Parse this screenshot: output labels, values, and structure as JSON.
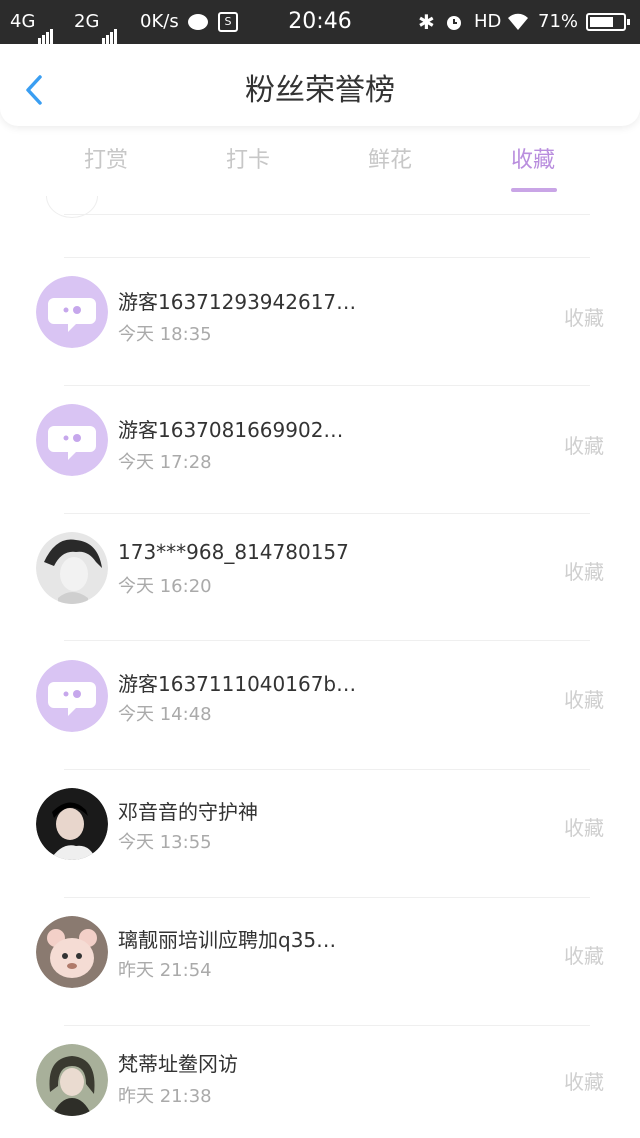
{
  "status_bar": {
    "network_1": "4G",
    "network_2": "2G",
    "speed": "0K/s",
    "time": "20:46",
    "hd": "HD",
    "battery_percent": "71%",
    "battery_level": 0.71
  },
  "header": {
    "title": "粉丝荣誉榜"
  },
  "tabs": [
    {
      "label": "打赏"
    },
    {
      "label": "打卡"
    },
    {
      "label": "鲜花"
    },
    {
      "label": "收藏",
      "active": true
    }
  ],
  "colors": {
    "accent": "#b98ede",
    "back": "#3a9ef2",
    "placeholder_avatar": "#d9c4f3"
  },
  "list": [
    {
      "name": "游客16371293942617…",
      "time": "今天 18:35",
      "action": "收藏",
      "avatar": "app-placeholder-avatar"
    },
    {
      "name": "游客1637081669902…",
      "time": "今天 17:28",
      "action": "收藏",
      "avatar": "app-placeholder-avatar"
    },
    {
      "name": "173***968_814780157",
      "time": "今天 16:20",
      "action": "收藏",
      "avatar": "user-photo-avatar"
    },
    {
      "name": "游客1637111040167b…",
      "time": "今天 14:48",
      "action": "收藏",
      "avatar": "app-placeholder-avatar"
    },
    {
      "name": "邓音音的守护神",
      "time": "今天 13:55",
      "action": "收藏",
      "avatar": "user-photo-avatar"
    },
    {
      "name": "璃靓丽培训应聘加q35…",
      "time": "昨天 21:54",
      "action": "收藏",
      "avatar": "user-photo-avatar"
    },
    {
      "name": "梵蒂址鲞冈访",
      "time": "昨天 21:38",
      "action": "收藏",
      "avatar": "user-photo-avatar"
    }
  ]
}
